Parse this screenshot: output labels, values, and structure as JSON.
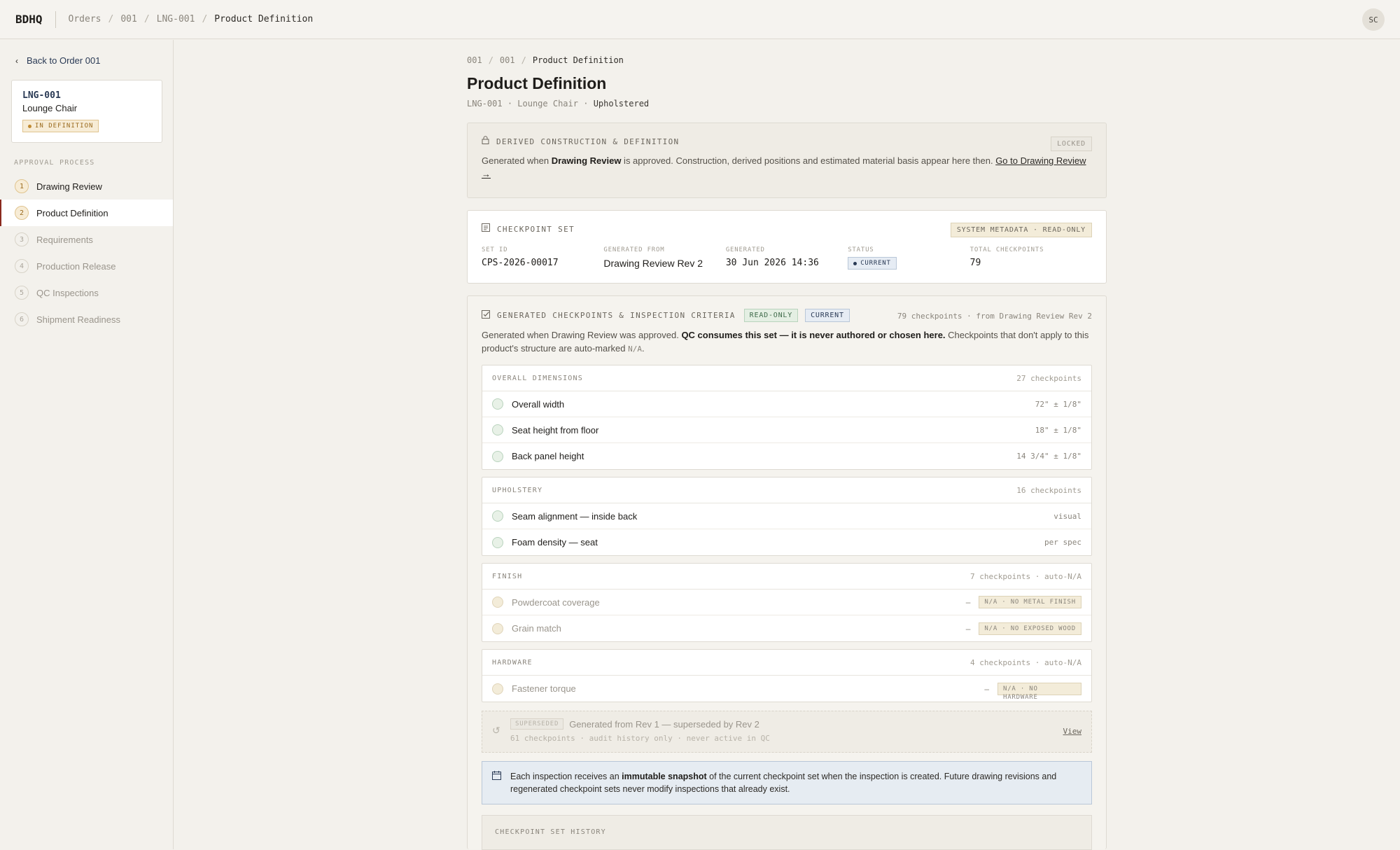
{
  "app": {
    "logo": "BDHQ",
    "avatar": "SC"
  },
  "topbar": {
    "crumbs": [
      "Orders",
      "001",
      "LNG-001",
      "Product Definition"
    ],
    "sep": "/"
  },
  "sidebar": {
    "back_label": "Back to Order 001",
    "item": {
      "code": "LNG-001",
      "name": "Lounge Chair",
      "badge": "IN DEFINITION"
    },
    "process_label": "APPROVAL PROCESS",
    "steps": [
      {
        "num": "1",
        "label": "Drawing Review"
      },
      {
        "num": "2",
        "label": "Product Definition"
      },
      {
        "num": "3",
        "label": "Requirements"
      },
      {
        "num": "4",
        "label": "Production Release"
      },
      {
        "num": "5",
        "label": "QC Inspections"
      },
      {
        "num": "6",
        "label": "Shipment Readiness"
      }
    ]
  },
  "page": {
    "crumbs": [
      "001",
      "001",
      "Product Definition"
    ],
    "title": "Product Definition",
    "sub_code": "LNG-001",
    "sub_name": "Lounge Chair",
    "sub_type": "Upholstered",
    "sub_sep": "·"
  },
  "derived": {
    "title": "DERIVED CONSTRUCTION & DEFINITION",
    "tag": "LOCKED",
    "text_a": "Generated when ",
    "text_b": "Drawing Review",
    "text_c": " is approved. Construction, derived positions and estimated material basis appear here then. ",
    "link": "Go to Drawing Review →"
  },
  "checkpoint_set": {
    "title": "CHECKPOINT SET",
    "tag": "SYSTEM METADATA · READ-ONLY",
    "fields": {
      "set_id_label": "SET ID",
      "set_id": "CPS-2026-00017",
      "from_label": "GENERATED FROM",
      "from": "Drawing Review Rev 2",
      "generated_label": "GENERATED",
      "generated": "30 Jun 2026 14:36",
      "status_label": "STATUS",
      "status": "CURRENT",
      "total_label": "TOTAL CHECKPOINTS",
      "total": "79"
    }
  },
  "generated": {
    "title": "GENERATED CHECKPOINTS & INSPECTION CRITERIA",
    "tag_ro": "READ-ONLY",
    "tag_cur": "CURRENT",
    "summary": "79 checkpoints · from Drawing Review Rev 2",
    "text_a": "Generated when Drawing Review was approved. ",
    "text_b": "QC consumes this set — it is never authored or chosen here.",
    "text_c": " Checkpoints that don't apply to this product's structure are auto-marked ",
    "text_code": "N/A",
    "text_d": ".",
    "groups": [
      {
        "title": "OVERALL DIMENSIONS",
        "count": "27 checkpoints",
        "rows": [
          {
            "label": "Overall width",
            "spec": "72\" ± 1/8\""
          },
          {
            "label": "Seat height from floor",
            "spec": "18\" ± 1/8\""
          },
          {
            "label": "Back panel height",
            "spec": "14 3/4\" ± 1/8\""
          }
        ]
      },
      {
        "title": "UPHOLSTERY",
        "count": "16 checkpoints",
        "rows": [
          {
            "label": "Seam alignment — inside back",
            "spec": "visual"
          },
          {
            "label": "Foam density — seat",
            "spec": "per spec"
          }
        ]
      },
      {
        "title": "FINISH",
        "count": "7 checkpoints · auto-N/A",
        "rows": [
          {
            "label": "Powdercoat coverage",
            "dash": "–",
            "na": "N/A · NO METAL FINISH"
          },
          {
            "label": "Grain match",
            "dash": "–",
            "na": "N/A · NO EXPOSED WOOD"
          }
        ]
      },
      {
        "title": "HARDWARE",
        "count": "4 checkpoints · auto-N/A",
        "rows": [
          {
            "label": "Fastener torque",
            "dash": "–",
            "na": "N/A · NO HARDWARE"
          }
        ]
      }
    ],
    "superseded": {
      "tag": "SUPERSEDED",
      "text": "Generated from Rev 1 — superseded by Rev 2",
      "meta": "61 checkpoints · audit history only · never active in QC",
      "view": "View"
    },
    "info": {
      "text_a": "Each inspection receives an ",
      "text_b": "immutable snapshot",
      "text_c": " of the current checkpoint set when the inspection is created. Future drawing revisions and regenerated checkpoint sets never modify inspections that already exist."
    },
    "history_title": "CHECKPOINT SET HISTORY"
  },
  "colors": {
    "accent": "#8a2a1e",
    "navy": "#2a3a55",
    "green": "#3f6a4a",
    "amber": "#9a6a1d"
  }
}
